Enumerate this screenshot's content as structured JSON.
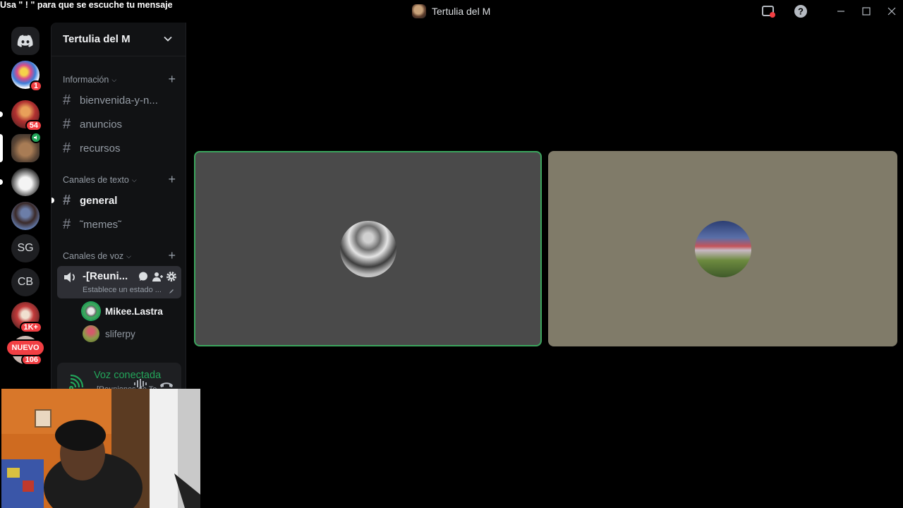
{
  "overlay": {
    "message": "Usa \" ! \" para que se escuche tu mensaje"
  },
  "window": {
    "title": "Tertulia del M"
  },
  "rail": {
    "servers": [
      {
        "name": "home",
        "badge": ""
      },
      {
        "name": "server-1",
        "badge": "1"
      },
      {
        "name": "server-2",
        "badge": "54"
      },
      {
        "name": "server-3",
        "badge": ""
      },
      {
        "name": "server-4",
        "badge": ""
      },
      {
        "name": "server-5",
        "badge": ""
      },
      {
        "name": "server-sg",
        "label": "SG"
      },
      {
        "name": "server-cb",
        "label": "CB"
      },
      {
        "name": "server-8",
        "badge": "1K+"
      }
    ],
    "nuevo_label": "NUEVO",
    "nuevo_count": "106"
  },
  "sidebar": {
    "guild_name": "Tertulia del M",
    "categories": [
      {
        "name": "Información",
        "channels": [
          "bienvenida-y-n...",
          "anuncios",
          "recursos"
        ]
      },
      {
        "name": "Canales de texto",
        "channels": [
          "general",
          "˜memes˜"
        ]
      },
      {
        "name": "Canales de voz"
      }
    ],
    "voice_channel": {
      "name": "-[Reuni...",
      "status": "Establece un estado ...",
      "members": [
        "Mikee.Lastra",
        "sliferpy"
      ]
    },
    "voice_panel": {
      "title": "Voz conectada",
      "subtitle": "[Reuniones de Te..."
    }
  },
  "colors": {
    "accent_green": "#23a55a",
    "badge_red": "#f23f43",
    "tile_1_bg": "#4a4a4a",
    "tile_2_bg": "#807b69"
  }
}
